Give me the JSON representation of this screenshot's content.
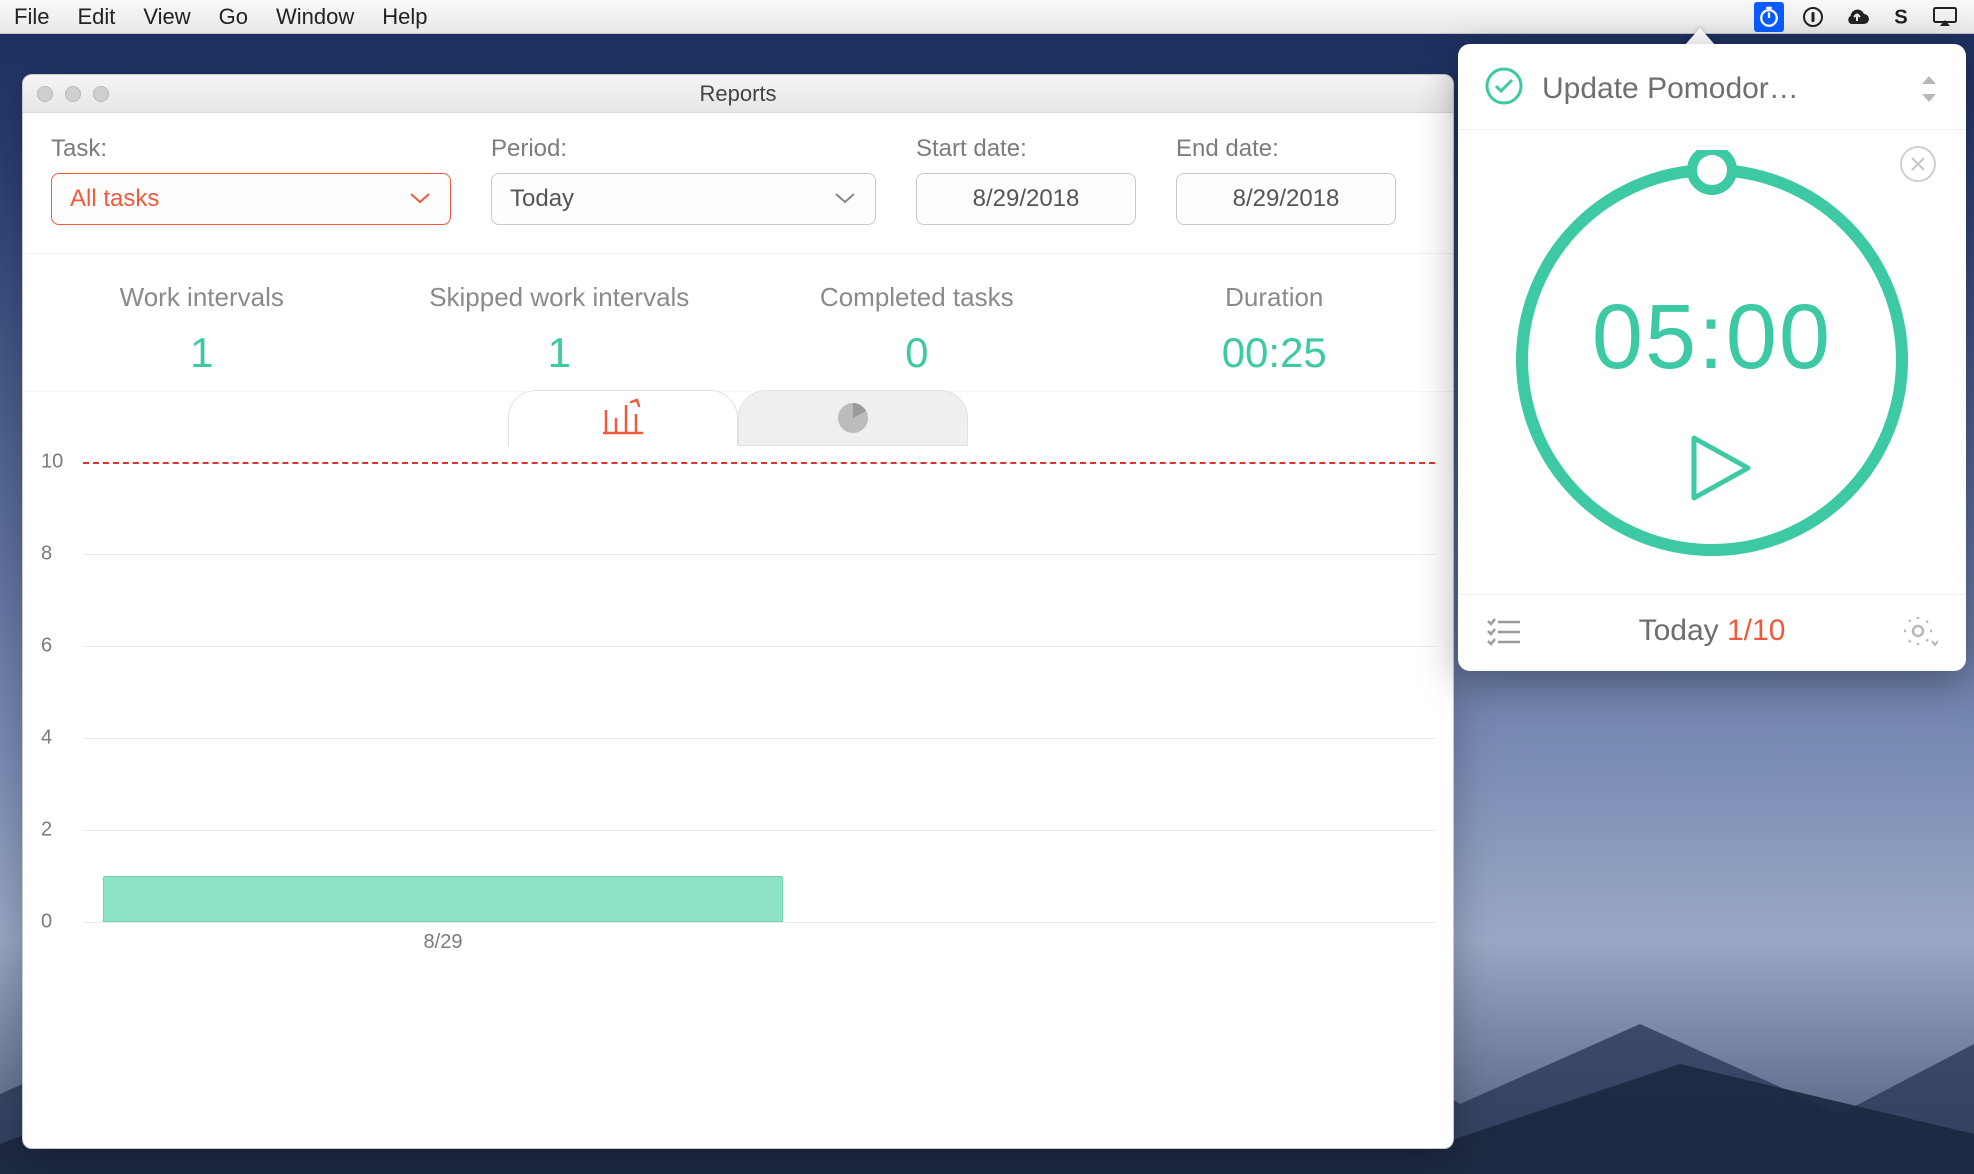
{
  "menubar": {
    "items": [
      "File",
      "Edit",
      "View",
      "Go",
      "Window",
      "Help"
    ],
    "right_icons": [
      "timer-icon",
      "onepassword-icon",
      "cloud-upload-icon",
      "s-icon",
      "airplay-icon"
    ]
  },
  "window": {
    "title": "Reports",
    "filters": {
      "task": {
        "label": "Task:",
        "value": "All tasks"
      },
      "period": {
        "label": "Period:",
        "value": "Today"
      },
      "start": {
        "label": "Start date:",
        "value": "8/29/2018"
      },
      "end": {
        "label": "End date:",
        "value": "8/29/2018"
      }
    },
    "stats": [
      {
        "name": "Work intervals",
        "value": "1"
      },
      {
        "name": "Skipped work intervals",
        "value": "1"
      },
      {
        "name": "Completed tasks",
        "value": "0"
      },
      {
        "name": "Duration",
        "value": "00:25"
      }
    ],
    "chart_tabs": {
      "active": "bar"
    }
  },
  "timer": {
    "task_name": "Update Pomodor…",
    "time": "05:00",
    "footer_label": "Today",
    "footer_ratio": "1/10"
  },
  "colors": {
    "accent_orange": "#ef5a3c",
    "teal": "#3cc9a3",
    "bar_fill": "#8de4c5",
    "target_line": "#d33"
  },
  "chart_data": {
    "type": "bar",
    "title": "",
    "xlabel": "",
    "ylabel": "",
    "categories": [
      "8/29"
    ],
    "values": [
      1
    ],
    "ylim": [
      0,
      10
    ],
    "yticks": [
      0,
      2,
      4,
      6,
      8,
      10
    ],
    "target_line": 10
  }
}
